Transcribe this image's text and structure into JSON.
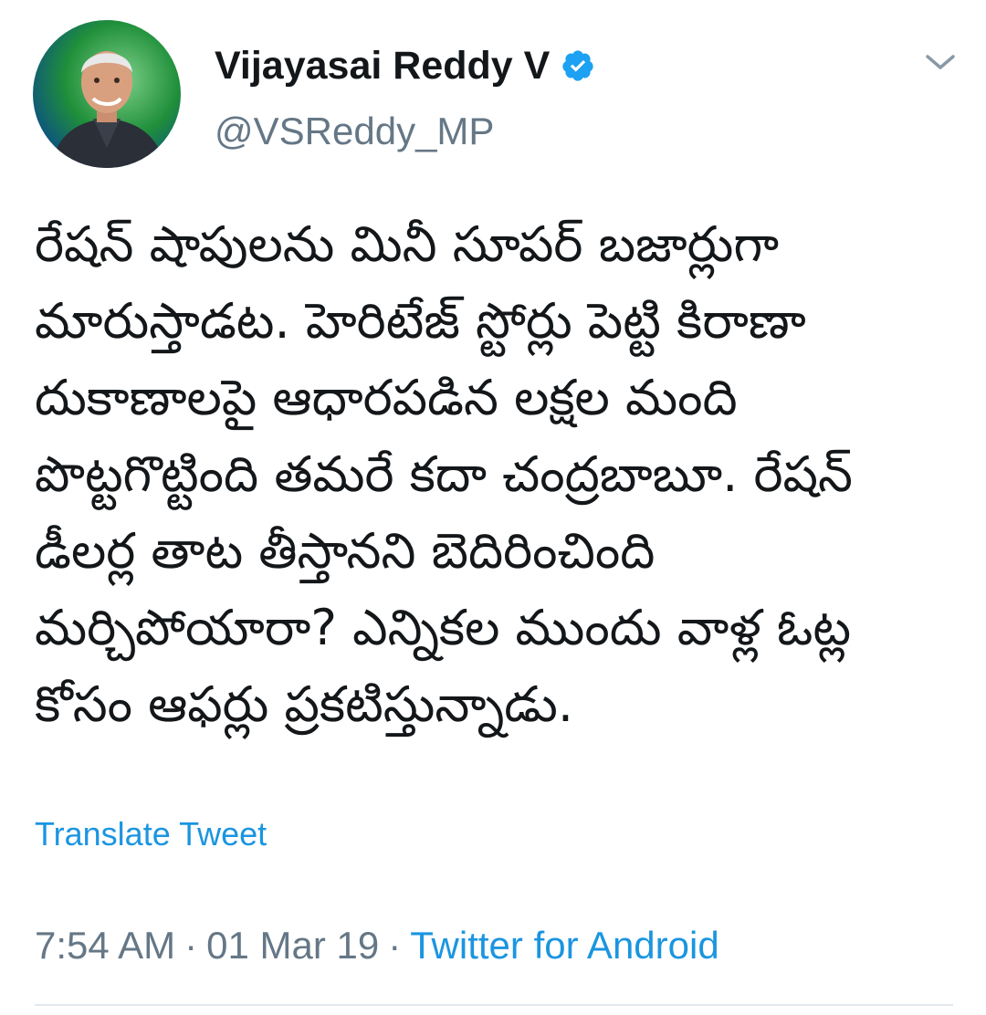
{
  "author": {
    "name": "Vijayasai Reddy V",
    "handle": "@VSReddy_MP",
    "verified": true
  },
  "icons": {
    "verified": "verified-badge-icon",
    "more": "chevron-down-icon"
  },
  "tweet": {
    "text": "రేషన్ షాపులను మినీ సూపర్ బజార్లుగా మారుస్తాడట. హెరిటేజ్ స్టోర్లు పెట్టి కిరాణా దుకాణాలపై ఆధారపడిన లక్షల మంది పొట్టగొట్టింది తమరే కదా చంద్రబాబూ. రేషన్ డీలర్ల తాట తీస్తానని బెదిరించింది మర్చిపోయారా? ఎన్నికల ముందు వాళ్ల ఓట్ల కోసం ఆఫర్లు ప్రకటిస్తున్నాడు.",
    "translate_label": "Translate Tweet",
    "time": "7:54 AM",
    "separator": "·",
    "date": "01 Mar 19",
    "source": "Twitter for Android"
  },
  "colors": {
    "link": "#1b95e0",
    "secondary_text": "#657786",
    "primary_text": "#14171a",
    "verified_badge": "#1da1f2",
    "divider": "#e1e8ed"
  }
}
